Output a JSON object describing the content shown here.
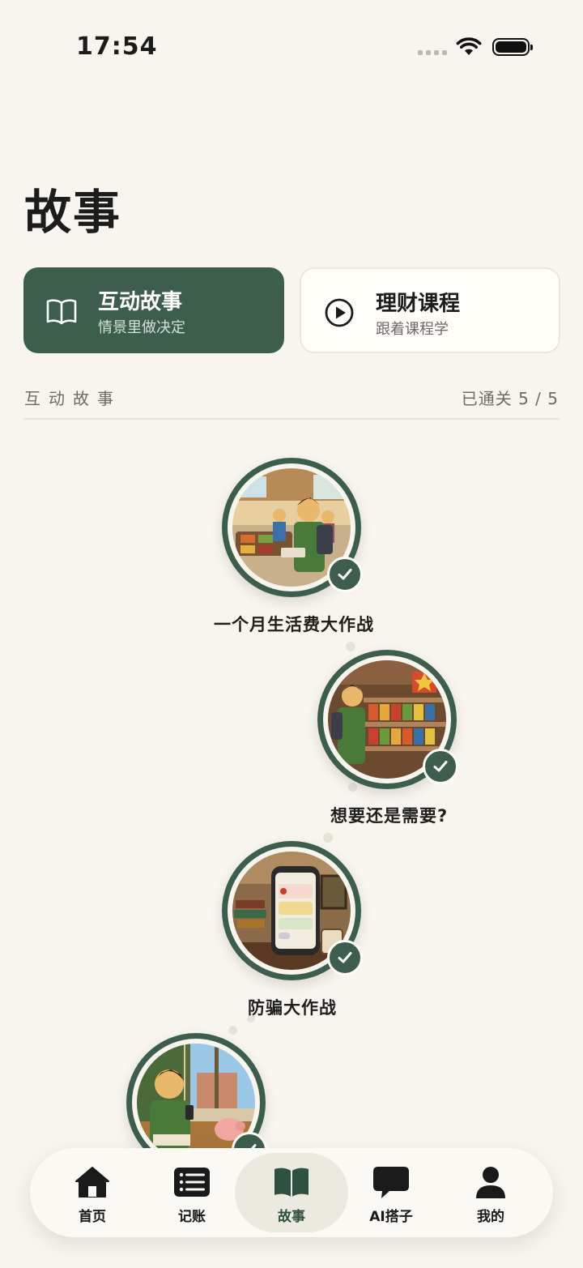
{
  "status_bar": {
    "time": "17:54"
  },
  "page_title": "故事",
  "modes": [
    {
      "title": "互动故事",
      "subtitle": "情景里做决定",
      "icon": "book-open-icon",
      "active": true
    },
    {
      "title": "理财课程",
      "subtitle": "跟着课程学",
      "icon": "play-circle-icon",
      "active": false
    }
  ],
  "section": {
    "label": "互动故事",
    "progress_prefix": "已通关",
    "progress": "5 / 5"
  },
  "stories": [
    {
      "title": "一个月生活费大作战",
      "completed": true
    },
    {
      "title": "想要还是需要?",
      "completed": true
    },
    {
      "title": "防骗大作战",
      "completed": true
    },
    {
      "title": "",
      "completed": true
    }
  ],
  "tab_bar": {
    "items": [
      {
        "label": "首页",
        "icon": "home-icon"
      },
      {
        "label": "记账",
        "icon": "list-icon"
      },
      {
        "label": "故事",
        "icon": "book-icon",
        "active": true
      },
      {
        "label": "AI搭子",
        "icon": "chat-bubble-icon"
      },
      {
        "label": "我的",
        "icon": "user-icon"
      }
    ]
  },
  "colors": {
    "accent": "#3e5e4d",
    "background": "#f8f5ee",
    "muted": "#6d6b66"
  }
}
